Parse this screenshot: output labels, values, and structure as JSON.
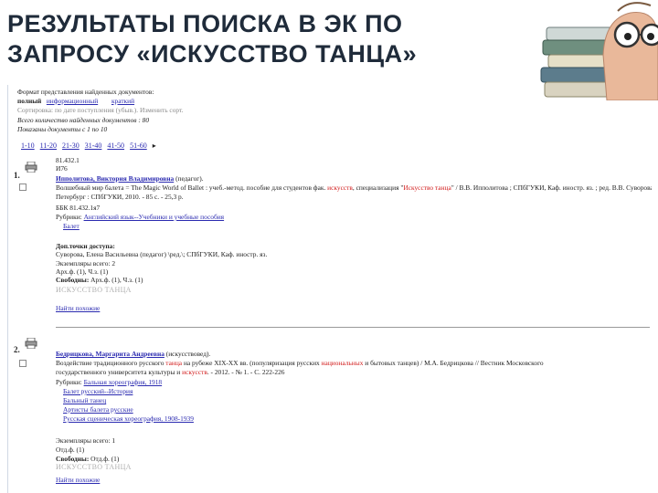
{
  "slide": {
    "title_line1": "РЕЗУЛЬТАТЫ ПОИСКА В ЭК ПО",
    "title_line2": "ЗАПРОСУ «ИСКУССТВО ТАНЦА»"
  },
  "header": {
    "format_label": "Формат представления найденных документов:",
    "formats": [
      "полный",
      "информационный",
      "краткий"
    ],
    "sort_label": "Сортировка: по дате поступления (убыв.). Изменить сорт.",
    "total": "Всего количество найденных документов : 80",
    "shown": "Показаны документы с 1 по 10",
    "pages": [
      "1-10",
      "11-20",
      "21-30",
      "31-40",
      "41-50",
      "51-60"
    ]
  },
  "records": [
    {
      "number": "1.",
      "call_numbers": [
        "81.432.1",
        "И76"
      ],
      "author": "Ипполитова, Виктория Владимировна",
      "author_role": "(педагог).",
      "desc_pre": "Волшебный мир балета = The Magic World of Ballet : учеб.-метод. пособие для студентов фак.",
      "desc_kw1": "искусств",
      "desc_mid": ", специализация \"",
      "desc_kw2": "Искусство танца",
      "desc_post": "\" / В.В. Ипполитова ; СПбГУКИ, Каф. иностр. яз. ; ред. В.В. Суворова. - Санкт-",
      "desc_line2": "Петербург : СПбГУКИ, 2010. - 85 с. - 25,3 р.",
      "bbk": "ББК 81.432.1я7",
      "rubrics_label": "Рубрики:",
      "rubrics": [
        "Английский язык--Учебники и учебные пособия",
        "Балет"
      ],
      "extra_label": "Доп.точки доступа:",
      "extra_line": "Суворова, Елена Васильевна (педагог) \\ред.\\; СПбГУКИ, Каф. иностр. яз.",
      "copies_label": "Экземпляры всего: 2",
      "copies_loc": "Арх.ф. (1), Ч.з. (1)",
      "free_label": "Свободны:",
      "free_value": "Арх.ф. (1), Ч.з. (1)",
      "stamp": "ИСКУССТВО ТАНЦА",
      "similar": "Найти похожие"
    },
    {
      "number": "2.",
      "author": "Бедрицкова, Маргарита Андреевна",
      "author_role": "(искусствовед).",
      "desc_pre": "Воздействие традиционного русского",
      "desc_kw1": "танца",
      "desc_mid": "на рубеже XIX-XX вв. (популяризация русских",
      "desc_kw2": "национальных",
      "desc_post": "и бытовых танцев) / М.А. Бедрицкова // Вестник Московского",
      "desc_line2_pre": "государственного университета культуры и",
      "desc_line2_kw": "искусств",
      "desc_line2_post": ". - 2012. - № 1. - С. 222-226",
      "rubrics_label": "Рубрики:",
      "rubrics": [
        "Бальная хореография, 1918",
        "Балет русский--История",
        "Бальный танец",
        "Артисты балета русские",
        "Русская сценическая хореография, 1908-1939"
      ],
      "copies_label": "Экземпляры всего: 1",
      "copies_loc": "Отд.ф. (1)",
      "free_label": "Свободны:",
      "free_value": "Отд.ф. (1)",
      "stamp": "ИСКУССТВО ТАНЦА",
      "similar": "Найти похожие"
    }
  ]
}
